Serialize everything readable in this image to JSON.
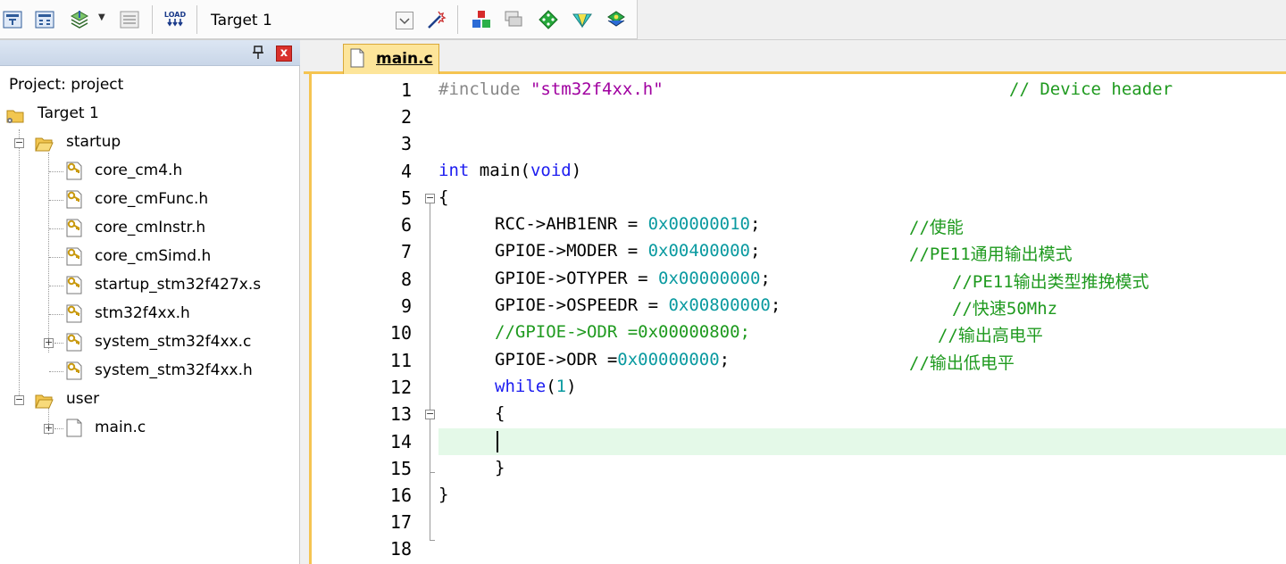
{
  "toolbar": {
    "target_name": "Target 1",
    "load_icon_text": "LOAD",
    "icons": [
      "translate-icon",
      "build-icon",
      "batch-build-icon",
      "rebuild-icon",
      "download-load-icon",
      "target-options-icon",
      "manage-project-icon",
      "file-extensions-icon",
      "pack-installer-icon",
      "select-packs-icon",
      "manage-rte-icon"
    ]
  },
  "project_panel": {
    "pin_symbol": "❙",
    "close_symbol": "x",
    "root_label": "Project: project",
    "target_label": "Target 1",
    "groups": [
      {
        "name": "startup",
        "files": [
          "core_cm4.h",
          "core_cmFunc.h",
          "core_cmInstr.h",
          "core_cmSimd.h",
          "startup_stm32f427x.s",
          "stm32f4xx.h",
          "system_stm32f4xx.c",
          "system_stm32f4xx.h"
        ]
      },
      {
        "name": "user",
        "files": [
          "main.c"
        ]
      }
    ]
  },
  "editor": {
    "tab_label": "main.c",
    "line_numbers": [
      "1",
      "2",
      "3",
      "4",
      "5",
      "6",
      "7",
      "8",
      "9",
      "10",
      "11",
      "12",
      "13",
      "14",
      "15",
      "16",
      "17",
      "18"
    ],
    "code": {
      "l1_pre": "#include",
      "l1_str": "\"stm32f4xx.h\"",
      "l1_cmt": "// Device header",
      "l4_kw1": "int",
      "l4_mid": " main(",
      "l4_kw2": "void",
      "l4_end": ")",
      "l5": "{",
      "l6_a": "RCC->AHB1ENR = ",
      "l6_num": "0x00000010",
      "l6_b": ";",
      "l6_cmt": "//使能",
      "l7_a": "GPIOE->MODER = ",
      "l7_num": "0x00400000",
      "l7_b": ";",
      "l7_cmt": "//PE11通用输出模式",
      "l8_a": "GPIOE->OTYPER = ",
      "l8_num": "0x00000000",
      "l8_b": ";",
      "l8_cmt": "//PE11输出类型推挽模式",
      "l9_a": "GPIOE->OSPEEDR = ",
      "l9_num": "0x00800000",
      "l9_b": ";",
      "l9_cmt": "//快速50Mhz",
      "l10_cmt": "//GPIOE->ODR =0x00000800;",
      "l10_cmt2": "//输出高电平",
      "l11_a": "GPIOE->ODR =",
      "l11_num": "0x00000000",
      "l11_b": ";",
      "l11_cmt": "//输出低电平",
      "l12_kw": "while",
      "l12_a": "(",
      "l12_num": "1",
      "l12_b": ")",
      "l13": "{",
      "l15": "}",
      "l16": "}"
    }
  },
  "colors": {
    "keyword": "#1c1cf0",
    "comment": "#1f9a1f",
    "string": "#a000a0",
    "number": "#0a9aa0",
    "current_line": "#e4f9e8",
    "tab_active": "#fde59a"
  }
}
